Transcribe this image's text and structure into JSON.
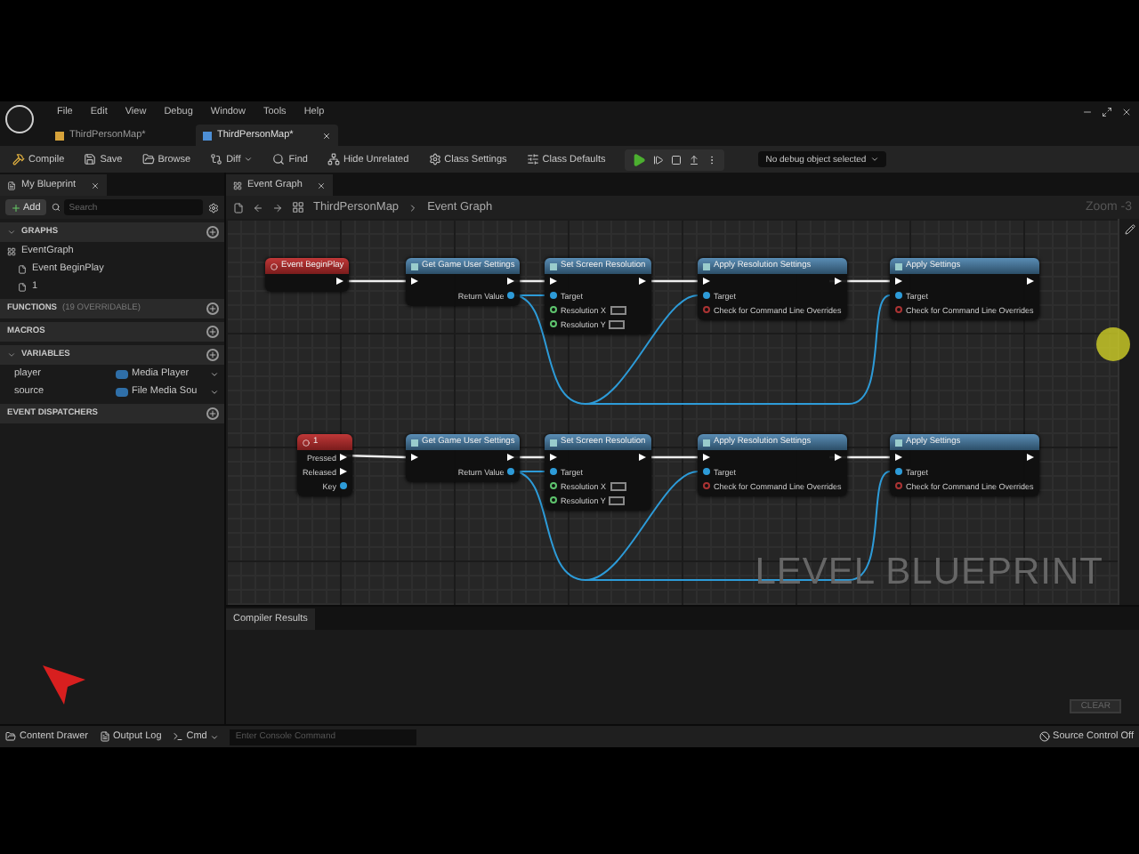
{
  "menu": [
    "File",
    "Edit",
    "View",
    "Debug",
    "Window",
    "Tools",
    "Help"
  ],
  "document_tabs": [
    {
      "label": "ThirdPersonMap*",
      "selected": false
    },
    {
      "label": "ThirdPersonMap*",
      "selected": true
    }
  ],
  "toolbar": {
    "buttons": [
      {
        "kind": "compile",
        "label": "Compile"
      },
      {
        "kind": "save",
        "label": "Save"
      },
      {
        "kind": "browse",
        "label": "Browse"
      },
      {
        "kind": "diff",
        "label": "Diff"
      },
      {
        "kind": "find",
        "label": "Find"
      },
      {
        "kind": "hide",
        "label": "Hide Unrelated"
      },
      {
        "kind": "settings",
        "label": "Class Settings"
      },
      {
        "kind": "defaults",
        "label": "Class Defaults"
      }
    ],
    "debug_filter": "No debug object selected"
  },
  "my_blueprint": {
    "tab": "My Blueprint",
    "add_button": "Add",
    "search": {
      "placeholder": "Search"
    },
    "sections": [
      {
        "title": "GRAPHS",
        "expanded": true,
        "items": [
          {
            "label": "EventGraph",
            "children": [
              {
                "label": "Event BeginPlay"
              },
              {
                "label": "1"
              }
            ]
          }
        ]
      },
      {
        "title": "FUNCTIONS",
        "note": "(19 OVERRIDABLE)",
        "expanded": false
      },
      {
        "title": "MACROS",
        "expanded": false
      },
      {
        "title": "VARIABLES",
        "expanded": true,
        "variables": [
          {
            "name": "player",
            "type": "Media Player"
          },
          {
            "name": "source",
            "type": "File Media Sou"
          }
        ]
      },
      {
        "title": "EVENT DISPATCHERS",
        "expanded": false
      }
    ]
  },
  "graph": {
    "tab": "Event Graph",
    "breadcrumb": [
      "ThirdPersonMap",
      "Event Graph"
    ],
    "zoom": "Zoom -3",
    "watermark": "LEVEL BLUEPRINT",
    "rows": [
      {
        "nodes": [
          {
            "kind": "event",
            "title": "Event BeginPlay"
          },
          {
            "kind": "function",
            "title": "Get Game User Settings",
            "pins": [
              {
                "kind": "output",
                "label": "Return Value"
              }
            ]
          },
          {
            "kind": "function",
            "title": "Set Screen Resolution",
            "pins": [
              {
                "kind": "target",
                "label": "Target"
              },
              {
                "kind": "int",
                "label": "Resolution X"
              },
              {
                "kind": "int",
                "label": "Resolution Y"
              }
            ]
          },
          {
            "kind": "function",
            "title": "Apply Resolution Settings",
            "pins": [
              {
                "kind": "target",
                "label": "Target"
              },
              {
                "kind": "bool",
                "label": "Check for Command Line Overrides"
              }
            ]
          },
          {
            "kind": "function",
            "title": "Apply Settings",
            "pins": [
              {
                "kind": "target",
                "label": "Target"
              },
              {
                "kind": "bool",
                "label": "Check for Command Line Overrides"
              }
            ]
          }
        ]
      },
      {
        "nodes": [
          {
            "kind": "key_event",
            "title": "1",
            "pins": [
              {
                "kind": "exec_out",
                "label": "Pressed"
              },
              {
                "kind": "exec_out",
                "label": "Released"
              },
              {
                "kind": "output",
                "label": "Key"
              }
            ]
          },
          {
            "kind": "function",
            "title": "Get Game User Settings",
            "pins": [
              {
                "kind": "output",
                "label": "Return Value"
              }
            ]
          },
          {
            "kind": "function",
            "title": "Set Screen Resolution",
            "pins": [
              {
                "kind": "target",
                "label": "Target"
              },
              {
                "kind": "int",
                "label": "Resolution X"
              },
              {
                "kind": "int",
                "label": "Resolution Y"
              }
            ]
          },
          {
            "kind": "function",
            "title": "Apply Resolution Settings",
            "pins": [
              {
                "kind": "target",
                "label": "Target"
              },
              {
                "kind": "bool",
                "label": "Check for Command Line Overrides"
              }
            ]
          },
          {
            "kind": "function",
            "title": "Apply Settings",
            "pins": [
              {
                "kind": "target",
                "label": "Target"
              },
              {
                "kind": "bool",
                "label": "Check for Command Line Overrides"
              }
            ]
          }
        ]
      }
    ]
  },
  "compiler_results": {
    "tab": "Compiler Results",
    "clear_button": "CLEAR"
  },
  "status_bar": {
    "content_drawer": "Content Drawer",
    "output_log": "Output Log",
    "cmd": "Cmd",
    "console": {
      "placeholder": "Enter Console Command"
    },
    "source_control": "Source Control Off"
  }
}
